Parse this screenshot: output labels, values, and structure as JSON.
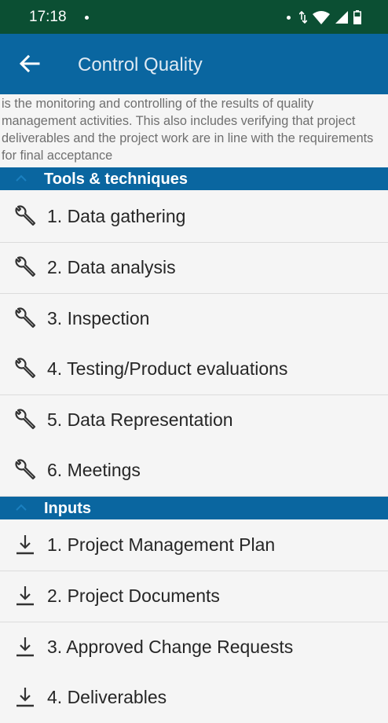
{
  "status_bar": {
    "time": "17:18",
    "icons": [
      "notification-dot-icon",
      "data-arrows-icon",
      "wifi-icon",
      "signal-icon",
      "battery-icon"
    ]
  },
  "app_bar": {
    "title": "Control Quality",
    "back_icon": "arrow-back-icon"
  },
  "description": "is the monitoring and controlling of the results of quality management activities. This also includes verifying that project deliverables and the project work are in line with the requirements for final acceptance",
  "sections": {
    "tools": {
      "title": "Tools & techniques",
      "icon": "wrench-icon",
      "items": [
        "1. Data gathering",
        "2. Data analysis",
        "3. Inspection",
        "4. Testing/Product evaluations",
        "5. Data Representation",
        "6. Meetings"
      ]
    },
    "inputs": {
      "title": "Inputs",
      "icon": "download-arrow-icon",
      "items": [
        "1. Project Management Plan",
        "2. Project Documents",
        "3. Approved Change Requests",
        "4. Deliverables"
      ]
    }
  },
  "colors": {
    "status_bar": "#0b4f33",
    "app_bar": "#0a66a0",
    "section_header": "#0a66a0",
    "background": "#f5f5f5"
  }
}
